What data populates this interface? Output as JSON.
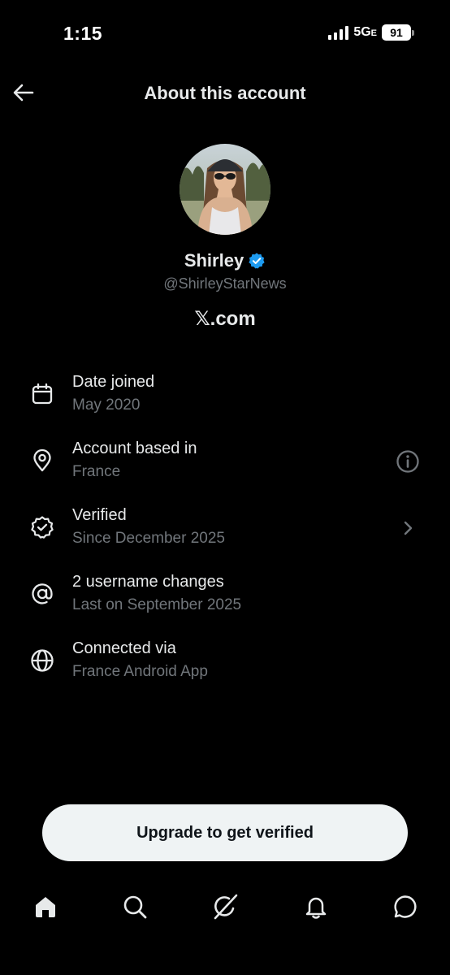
{
  "status_bar": {
    "time": "1:15",
    "network": "5G",
    "network_suffix": "E",
    "battery": "91"
  },
  "header": {
    "title": "About this account"
  },
  "profile": {
    "display_name": "Shirley",
    "handle": "@ShirleyStarNews",
    "platform": "𝕏.com",
    "verified_color": "#1d9bf0"
  },
  "info": {
    "items": [
      {
        "icon": "calendar-icon",
        "title": "Date joined",
        "subtitle": "May 2020"
      },
      {
        "icon": "location-pin-icon",
        "title": "Account based in",
        "subtitle": "France",
        "action_icon": "info-icon"
      },
      {
        "icon": "verified-seal-icon",
        "title": "Verified",
        "subtitle": "Since December 2025",
        "action_icon": "chevron-right-icon"
      },
      {
        "icon": "at-sign-icon",
        "title": "2 username changes",
        "subtitle": "Last on September 2025"
      },
      {
        "icon": "globe-icon",
        "title": "Connected via",
        "subtitle": "France Android App"
      }
    ]
  },
  "upgrade": {
    "label": "Upgrade to get verified"
  },
  "nav": {
    "items": [
      "home-icon",
      "search-icon",
      "grok-icon",
      "notifications-icon",
      "messages-icon"
    ]
  },
  "colors": {
    "background": "#000000",
    "text_primary": "#e7e9ea",
    "text_secondary": "#71767b",
    "button_bg": "#eff3f4"
  }
}
